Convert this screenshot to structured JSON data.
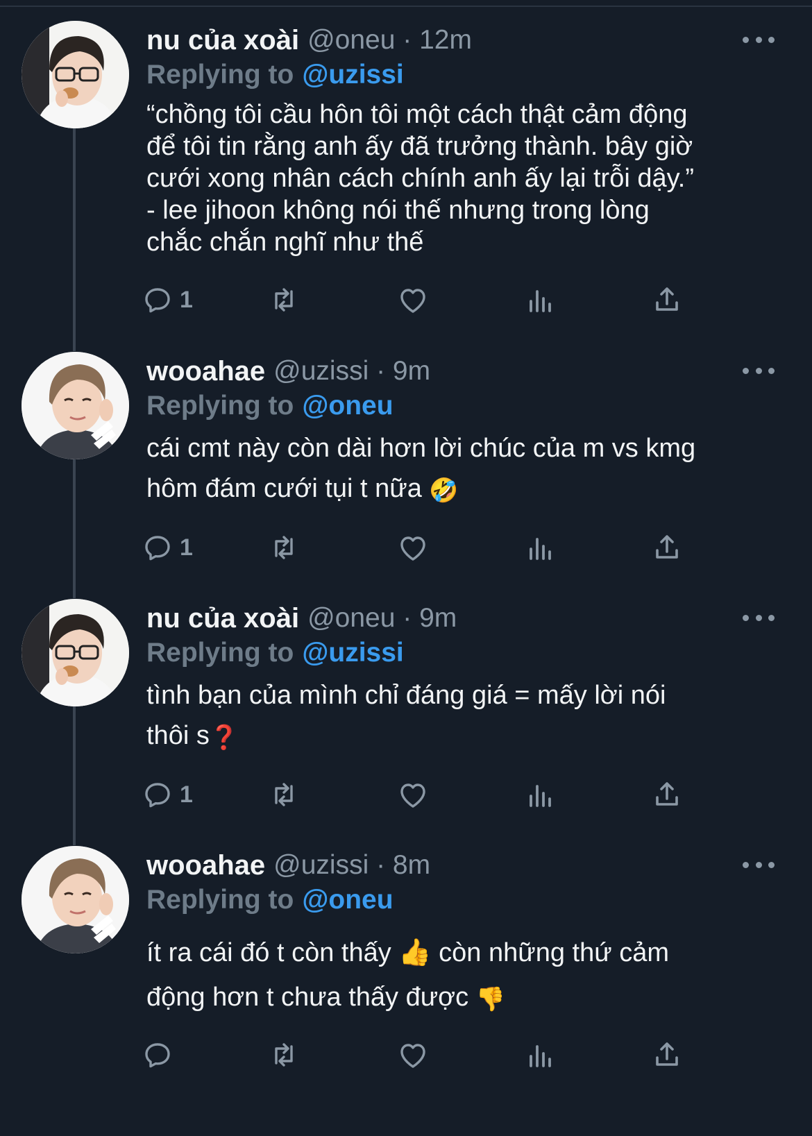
{
  "tweets": [
    {
      "name": "nu của xoài",
      "handle": "@oneu",
      "time": "12m",
      "meta": "@oneu · 12m",
      "replying_label": "Replying to",
      "replying_to": "@uzissi",
      "text": "“chồng tôi cầu hôn tôi một cách thật cảm động\nđể tôi tin rằng anh ấy đã trưởng thành. bây giờ\ncưới xong nhân cách chính anh ấy lại trỗi dậy.”\n- lee jihoon không nói thế nhưng trong lòng\nchắc chắn nghĩ như thế",
      "emoji": "",
      "reply_count": "1"
    },
    {
      "name": "wooahae",
      "handle": "@uzissi",
      "time": "9m",
      "meta": "@uzissi · 9m",
      "replying_label": "Replying to",
      "replying_to": "@oneu",
      "text": "cái cmt này còn dài hơn lời chúc của m vs kmg\nhôm đám cưới tụi t nữa ",
      "emoji": "🤣",
      "reply_count": "1"
    },
    {
      "name": "nu của xoài",
      "handle": "@oneu",
      "time": "9m",
      "meta": "@oneu · 9m",
      "replying_label": "Replying to",
      "replying_to": "@uzissi",
      "text": "tình bạn của mình chỉ đáng giá = mấy lời nói\nthôi s",
      "emoji": "❓",
      "reply_count": "1"
    },
    {
      "name": "wooahae",
      "handle": "@uzissi",
      "time": "8m",
      "meta": "@uzissi · 8m",
      "replying_label": "Replying to",
      "replying_to": "@oneu",
      "text": "ít ra cái đó t còn thấy 👍  còn những thứ cảm\nđộng hơn t chưa thấy được ",
      "emoji": "👎",
      "reply_count": ""
    }
  ],
  "icons": [
    "reply-icon",
    "retweet-icon",
    "like-icon",
    "analytics-icon",
    "share-icon",
    "more-icon"
  ],
  "colors": {
    "background": "#151d28",
    "accent": "#3a9bee",
    "muted": "#8b98a5",
    "text": "#f2f4f5"
  }
}
